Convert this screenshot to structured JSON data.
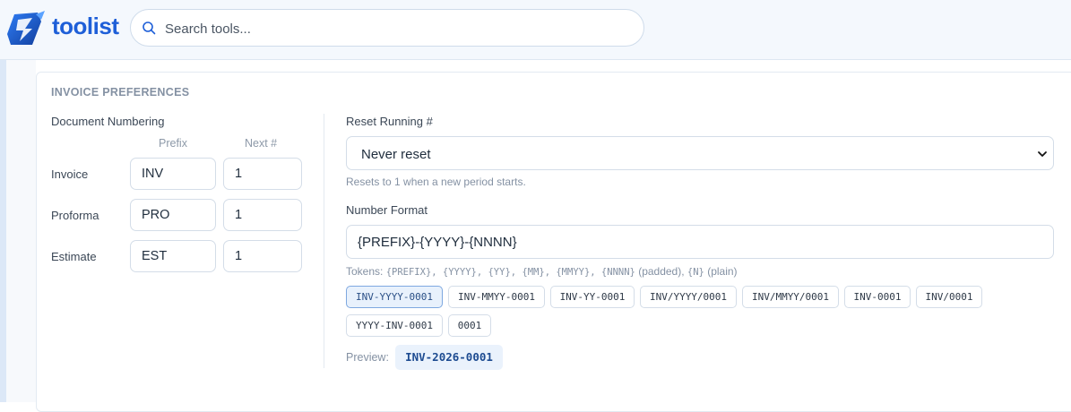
{
  "app": {
    "brand": "toolist"
  },
  "search": {
    "placeholder": "Search tools..."
  },
  "section": {
    "title": "INVOICE PREFERENCES"
  },
  "numbering": {
    "title": "Document Numbering",
    "col_prefix": "Prefix",
    "col_next": "Next #",
    "rows": [
      {
        "label": "Invoice",
        "prefix": "INV",
        "next": "1"
      },
      {
        "label": "Proforma",
        "prefix": "PRO",
        "next": "1"
      },
      {
        "label": "Estimate",
        "prefix": "EST",
        "next": "1"
      }
    ]
  },
  "reset": {
    "label": "Reset Running #",
    "selected": "Never reset",
    "help": "Resets to 1 when a new period starts."
  },
  "format": {
    "label": "Number Format",
    "value": "{PREFIX}-{YYYY}-{NNNN}",
    "tokens_prefix": "Tokens: ",
    "tokens_codes": "{PREFIX}, {YYYY}, {YY}, {MM}, {MMYY}, {NNNN}",
    "tokens_padded": " (padded), ",
    "tokens_n": "{N}",
    "tokens_plain": " (plain)",
    "presets": [
      "INV-YYYY-0001",
      "INV-MMYY-0001",
      "INV-YY-0001",
      "INV/YYYY/0001",
      "INV/MMYY/0001",
      "INV-0001",
      "INV/0001",
      "YYYY-INV-0001",
      "0001"
    ],
    "active_preset": "INV-YYYY-0001"
  },
  "preview": {
    "label": "Preview:",
    "value": "INV-2026-0001"
  },
  "colors": {
    "accent": "#1e5fd8",
    "chip_active_bg": "#e8f1fc",
    "preview_text": "#1d4b91"
  }
}
